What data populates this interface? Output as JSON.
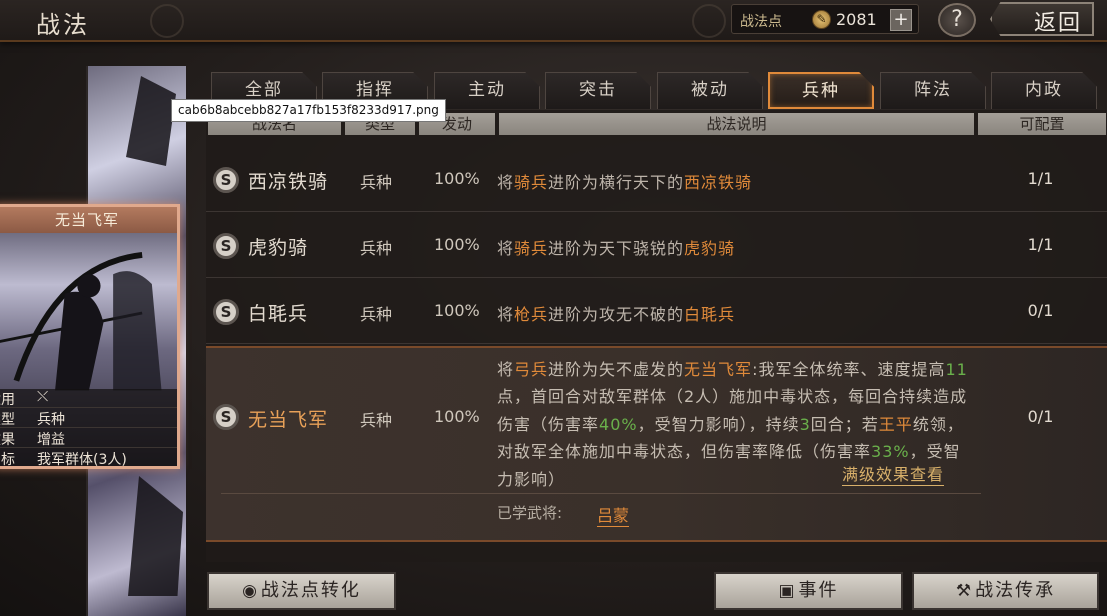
{
  "header": {
    "title": "战法",
    "points_label": "战法点",
    "points_value": "2081",
    "help_label": "?",
    "back_label": "返回"
  },
  "card": {
    "title": "无当飞军",
    "rows": [
      {
        "key": "适用",
        "value": "⤬"
      },
      {
        "key": "类型",
        "value": "兵种"
      },
      {
        "key": "效果",
        "value": "增益"
      },
      {
        "key": "目标",
        "value": "我军群体(3人)"
      }
    ]
  },
  "tabs": [
    "全部",
    "指挥",
    "主动",
    "突击",
    "被动",
    "兵种",
    "阵法",
    "内政"
  ],
  "active_tab": "兵种",
  "table": {
    "headers": [
      "战法名",
      "类型",
      "发动",
      "战法说明",
      "可配置"
    ],
    "rows": [
      {
        "badge": "S",
        "name": "西凉铁骑",
        "type": "兵种",
        "rate": "100%",
        "desc": [
          {
            "t": "将",
            "c": ""
          },
          {
            "t": "骑兵",
            "c": "hl"
          },
          {
            "t": "进阶为横行天下的",
            "c": ""
          },
          {
            "t": "西凉铁骑",
            "c": "hl"
          }
        ],
        "cfg": "1/1",
        "cfg_color": "normal"
      },
      {
        "badge": "S",
        "name": "虎豹骑",
        "type": "兵种",
        "rate": "100%",
        "desc": [
          {
            "t": "将",
            "c": ""
          },
          {
            "t": "骑兵",
            "c": "hl"
          },
          {
            "t": "进阶为天下骁锐的",
            "c": ""
          },
          {
            "t": "虎豹骑",
            "c": "hl"
          }
        ],
        "cfg": "1/1",
        "cfg_color": "normal"
      },
      {
        "badge": "S",
        "name": "白毦兵",
        "type": "兵种",
        "rate": "100%",
        "desc": [
          {
            "t": "将",
            "c": ""
          },
          {
            "t": "枪兵",
            "c": "hl"
          },
          {
            "t": "进阶为攻无不破的",
            "c": ""
          },
          {
            "t": "白毦兵",
            "c": "hl"
          }
        ],
        "cfg": "0/1",
        "cfg_color": "red"
      }
    ],
    "selected": {
      "badge": "S",
      "name": "无当飞军",
      "type": "兵种",
      "rate": "100%",
      "cfg": "0/1",
      "desc": [
        {
          "t": "将",
          "c": ""
        },
        {
          "t": "弓兵",
          "c": "hl"
        },
        {
          "t": "进阶为矢不虚发的",
          "c": ""
        },
        {
          "t": "无当飞军",
          "c": "hl"
        },
        {
          "t": ":我军全体统率、速度提高",
          "c": ""
        },
        {
          "t": "11",
          "c": "grn"
        },
        {
          "t": "点，首回合对敌军群体（2人）施加中毒状态，每回合持续造成伤害（伤害率",
          "c": ""
        },
        {
          "t": "40%",
          "c": "grn"
        },
        {
          "t": "，受智力影响），持续",
          "c": ""
        },
        {
          "t": "3",
          "c": "grn"
        },
        {
          "t": "回合；若",
          "c": ""
        },
        {
          "t": "王平",
          "c": "hl"
        },
        {
          "t": "统领，对敌军全体施加中毒状态，但伤害率降低（伤害率",
          "c": ""
        },
        {
          "t": "33%",
          "c": "grn"
        },
        {
          "t": "，受智力影响）",
          "c": ""
        }
      ],
      "more_link": "满级效果查看",
      "learned_label": "已学武将:",
      "learned_value": "吕蒙"
    }
  },
  "buttons": {
    "convert": "战法点转化",
    "event": "事件",
    "inherit": "战法传承"
  },
  "tooltip": "cab6b8abcebb827a17fb153f8233d917.png"
}
